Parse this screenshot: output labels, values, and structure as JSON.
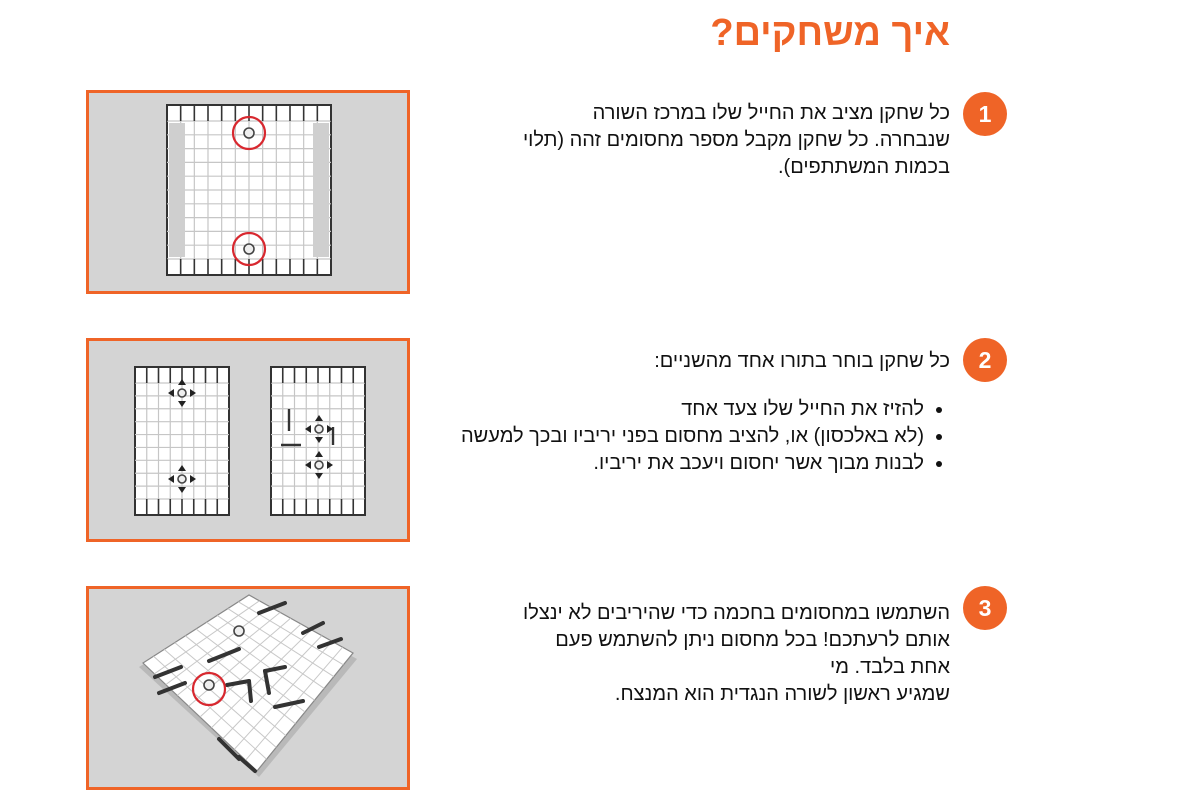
{
  "title": "איך משחקים?",
  "steps": [
    {
      "number": "1",
      "lines": [
        "כל שחקן מציב את החייל שלו במרכז השורה",
        "שנבחרה. כל שחקן מקבל מספר מחסומים זהה (תלוי",
        "בכמות המשתתפים)."
      ]
    },
    {
      "number": "2",
      "intro": "כל שחקן בוחר בתורו אחד מהשניים:",
      "bullets": [
        "להזיז את החייל שלו צעד אחד",
        "(לא באלכסון) או, להציב מחסום בפני יריביו ובכך למעשה",
        "לבנות מבוך אשר יחסום ויעכב את יריביו."
      ]
    },
    {
      "number": "3",
      "lines": [
        "השתמשו במחסומים בחכמה כדי שהיריבים לא ינצלו",
        "אותם  לרעתכם! בכל מחסום ניתן להשתמש פעם",
        "אחת בלבד. מי",
        "שמגיע ראשון לשורה הנגדית הוא המנצח."
      ]
    }
  ],
  "colors": {
    "accent": "#ef6427",
    "panel_bg": "#d4d4d4",
    "highlight": "#d8282f"
  }
}
